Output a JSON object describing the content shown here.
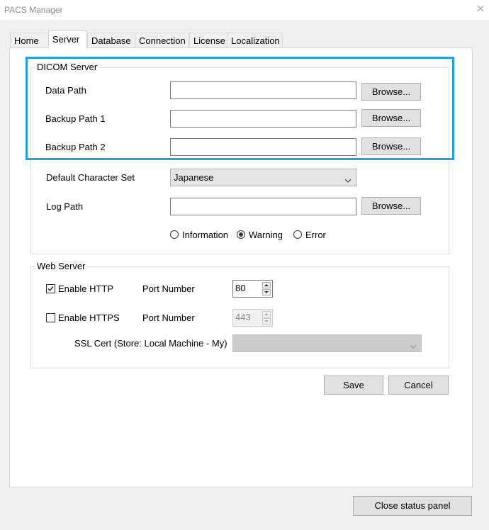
{
  "window": {
    "title": "PACS Manager"
  },
  "tabs": [
    {
      "label": "Home"
    },
    {
      "label": "Server"
    },
    {
      "label": "Database"
    },
    {
      "label": "Connection"
    },
    {
      "label": "License"
    },
    {
      "label": "Localization"
    }
  ],
  "dicom_server": {
    "title": "DICOM Server",
    "data_path": {
      "label": "Data Path",
      "value": "",
      "browse": "Browse..."
    },
    "backup_path_1": {
      "label": "Backup Path 1",
      "value": "",
      "browse": "Browse..."
    },
    "backup_path_2": {
      "label": "Backup Path 2",
      "value": "",
      "browse": "Browse..."
    },
    "charset": {
      "label": "Default Character Set",
      "selected": "Japanese"
    },
    "log_path": {
      "label": "Log Path",
      "value": "",
      "browse": "Browse..."
    },
    "log_level": {
      "options": [
        "Information",
        "Warning",
        "Error"
      ],
      "selected": "Warning"
    }
  },
  "web_server": {
    "title": "Web Server",
    "http": {
      "label": "Enable HTTP",
      "checked": true,
      "port_label": "Port Number",
      "port": "80"
    },
    "https": {
      "label": "Enable HTTPS",
      "checked": false,
      "port_label": "Port Number",
      "port": "443"
    },
    "ssl_cert": {
      "label": "SSL Cert (Store: Local Machine - My)",
      "selected": ""
    }
  },
  "actions": {
    "save": "Save",
    "cancel": "Cancel",
    "close_status": "Close status panel"
  },
  "colors": {
    "highlight": "#1ea2e0",
    "window_bg": "#f0f0f0",
    "panel_bg": "#ffffff"
  }
}
